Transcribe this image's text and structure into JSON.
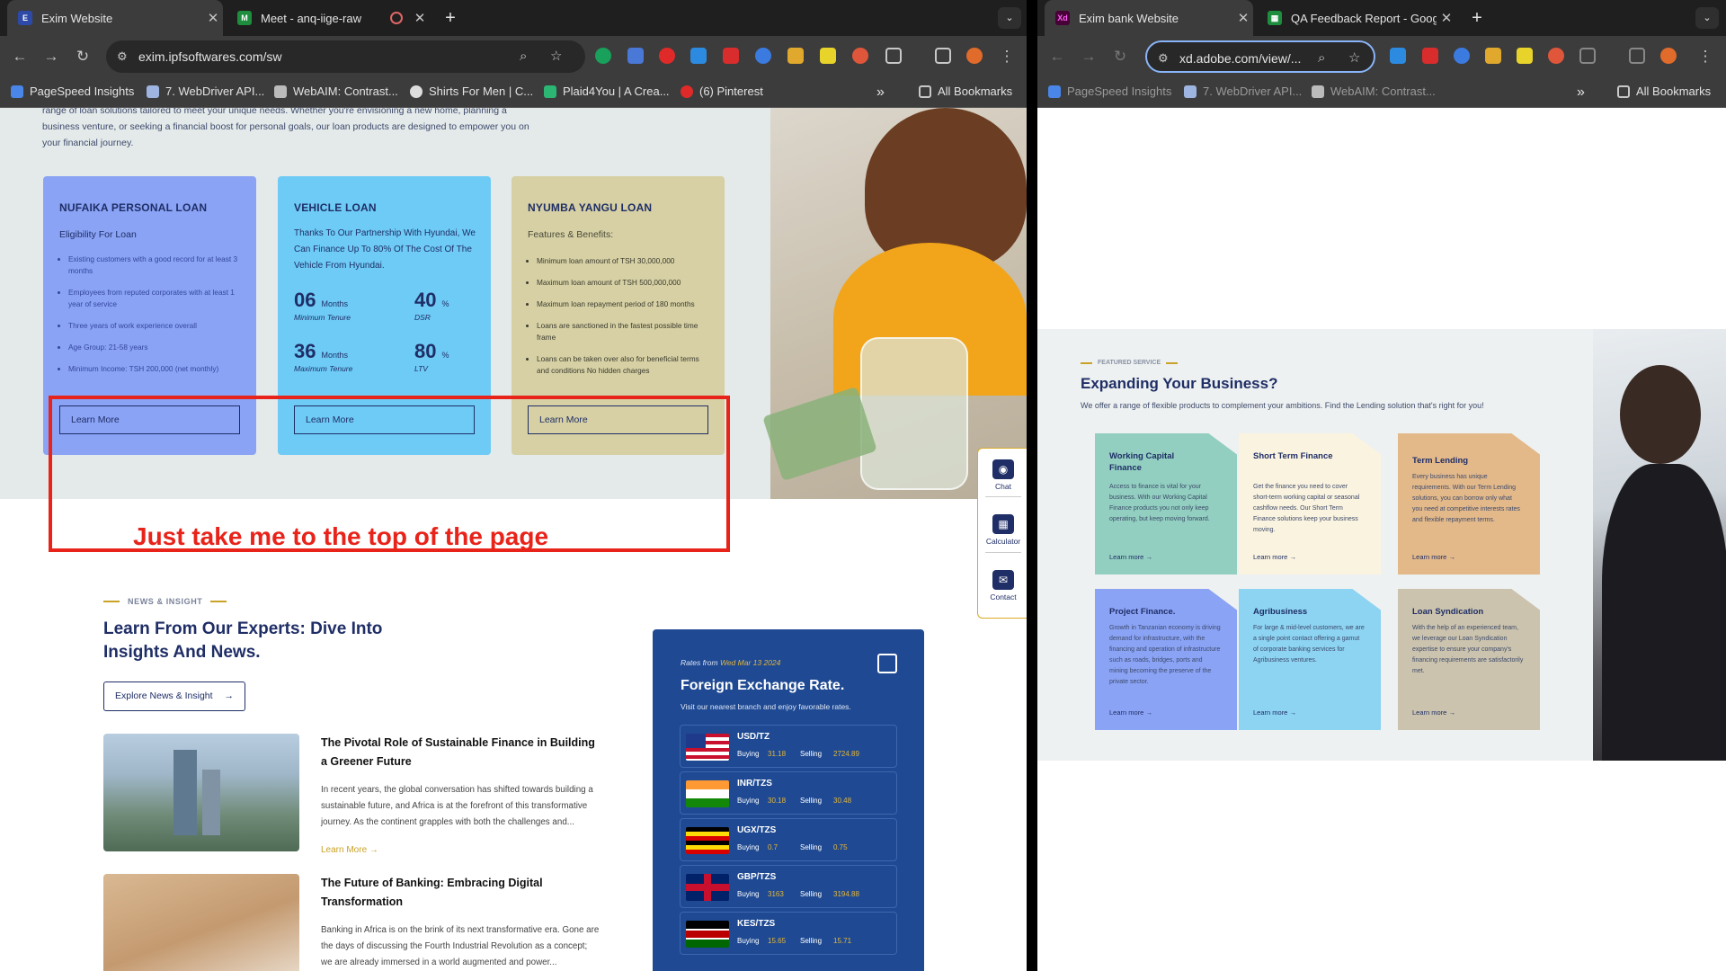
{
  "left": {
    "tabs": [
      {
        "title": "Exim Website",
        "active": true
      },
      {
        "title": "Meet - anq-iige-raw",
        "active": false
      }
    ],
    "url": "exim.ipfsoftwares.com/sw",
    "bookmarks": [
      "PageSpeed Insights",
      "7. WebDriver API...",
      "WebAIM: Contrast...",
      "Shirts For Men | C...",
      "Plaid4You | A Crea...",
      "(6) Pinterest"
    ],
    "all_bookmarks": "All Bookmarks",
    "page": {
      "intro": "range of loan solutions tailored to meet your unique needs. Whether you're envisioning a new home, planning a business venture, or seeking a financial boost for personal goals, our loan products are designed to empower you on your financial journey.",
      "cards": [
        {
          "title": "NUFAIKA PERSONAL LOAN",
          "subtitle": "Eligibility For Loan",
          "bullets": [
            "Existing customers with a good record for at least 3 months",
            "Employees from reputed corporates with at least 1 year of service",
            "Three years of work experience overall",
            "Age Group: 21-58 years",
            "Minimum Income: TSH 200,000 (net monthly)"
          ],
          "button": "Learn More",
          "color": "#8aa3f5"
        },
        {
          "title": "VEHICLE LOAN",
          "description": "Thanks To Our Partnership With Hyundai, We Can Finance Up To 80% Of The Cost Of The Vehicle From Hyundai.",
          "stats": [
            {
              "value": "06",
              "unit": "Months",
              "label": "Minimum Tenure"
            },
            {
              "value": "40",
              "unit": "%",
              "label": "DSR"
            },
            {
              "value": "36",
              "unit": "Months",
              "label": "Maximum Tenure"
            },
            {
              "value": "80",
              "unit": "%",
              "label": "LTV"
            }
          ],
          "button": "Learn More",
          "color": "#6ecbf6"
        },
        {
          "title": "NYUMBA YANGU LOAN",
          "subtitle": "Features & Benefits:",
          "bullets": [
            "Minimum loan amount of TSH 30,000,000",
            "Maximum loan amount of TSH 500,000,000",
            "Maximum loan repayment period of 180 months",
            "Loans are sanctioned in the fastest possible time frame",
            "Loans can be taken over also for beneficial terms and conditions No hidden charges"
          ],
          "button": "Learn More",
          "color": "#d6d0a4"
        }
      ],
      "annotation": "Just take me to the top of the page",
      "widget": [
        "Chat",
        "Calculator",
        "Contact"
      ],
      "news": {
        "eyebrow": "NEWS & INSIGHT",
        "title": "Learn From Our Experts: Dive Into Insights And News.",
        "explore": "Explore News & Insight",
        "items": [
          {
            "title": "The Pivotal Role of Sustainable Finance in Building a Greener Future",
            "body": "In recent years, the global conversation has shifted towards building a sustainable future, and Africa is at the forefront of this transformative journey. As the continent grapples with both the challenges and...",
            "more": "Learn More"
          },
          {
            "title": "The Future of Banking: Embracing Digital Transformation",
            "body": "Banking in Africa is on the brink of its next transformative era. Gone are the days of discussing the Fourth Industrial Revolution as a concept; we are already immersed in a world augmented and power..."
          }
        ]
      },
      "fx": {
        "rates_from": "Rates from",
        "date": "Wed Mar 13 2024",
        "title": "Foreign Exchange Rate.",
        "subtitle": "Visit our nearest branch and enjoy favorable rates.",
        "buying_label": "Buying",
        "selling_label": "Selling",
        "rows": [
          {
            "pair": "USD/TZ",
            "buying": "31.18",
            "selling": "2724.89"
          },
          {
            "pair": "INR/TZS",
            "buying": "30.18",
            "selling": "30.48"
          },
          {
            "pair": "UGX/TZS",
            "buying": "0.7",
            "selling": "0.75"
          },
          {
            "pair": "GBP/TZS",
            "buying": "3163",
            "selling": "3194.88"
          },
          {
            "pair": "KES/TZS",
            "buying": "15.65",
            "selling": "15.71"
          }
        ]
      }
    }
  },
  "right": {
    "tabs": [
      {
        "title": "Exim bank Website",
        "active": true
      },
      {
        "title": "QA Feedback Report - Googl",
        "active": false
      }
    ],
    "url": "xd.adobe.com/view/...",
    "bookmarks": [
      "PageSpeed Insights",
      "7. WebDriver API...",
      "WebAIM: Contrast..."
    ],
    "all_bookmarks": "All Bookmarks",
    "page": {
      "eyebrow": "FEATURED SERVICE",
      "title": "Expanding Your Business?",
      "subtitle": "We offer a range of flexible products to complement your ambitions. Find the Lending solution that's right for you!",
      "services": [
        {
          "title": "Working Capital Finance",
          "body": "Access to finance is vital for your business. With our Working Capital Finance products you not only keep operating, but keep moving forward.",
          "more": "Learn more",
          "color": "#92cfc0"
        },
        {
          "title": "Short Term Finance",
          "body": "Get the finance you need to cover short-term working capital or seasonal cashflow needs. Our Short Term Finance solutions keep your business moving.",
          "more": "Learn more",
          "color": "#faf3df"
        },
        {
          "title": "Term Lending",
          "body": "Every business has unique requirements. With our Term Lending solutions, you can borrow only what you need at competitive interests rates and flexible repayment terms.",
          "more": "Learn more",
          "color": "#e3b98a"
        },
        {
          "title": "Project Finance.",
          "body": "Growth in Tanzanian economy is driving demand for infrastructure, with the financing and operation of infrastructure such as roads, bridges, ports and mining becoming the preserve of the private sector.",
          "more": "Learn more",
          "color": "#8aa3f5"
        },
        {
          "title": "Agribusiness",
          "body": "For large & mid-level customers, we are a single point contact offering a gamut of corporate banking services for Agribusiness ventures.",
          "more": "Learn more",
          "color": "#8dd3f2"
        },
        {
          "title": "Loan Syndication",
          "body": "With the help of an experienced team, we leverage our Loan Syndication expertise to ensure your company's financing requirements are satisfactorily met.",
          "more": "Learn more",
          "color": "#cbc3ad"
        }
      ]
    }
  }
}
